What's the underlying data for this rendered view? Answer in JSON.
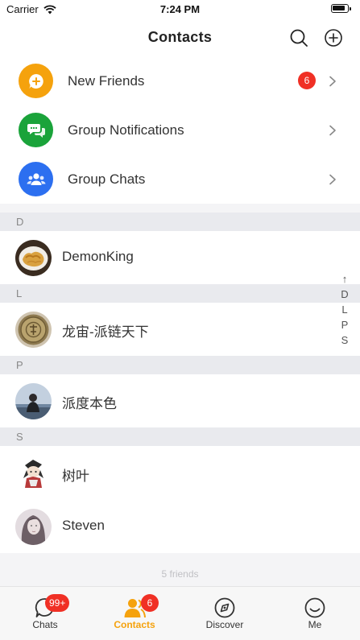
{
  "status_bar": {
    "carrier": "Carrier",
    "time": "7:24 PM"
  },
  "nav": {
    "title": "Contacts"
  },
  "functions": [
    {
      "label": "New Friends",
      "badge": "6",
      "color": "#f5a20d",
      "icon": "plus-chat-icon"
    },
    {
      "label": "Group Notifications",
      "badge": "",
      "color": "#1aa33a",
      "icon": "chat-bubbles-icon"
    },
    {
      "label": "Group Chats",
      "badge": "",
      "color": "#2c6ff0",
      "icon": "group-icon"
    }
  ],
  "sections": [
    {
      "letter": "D",
      "contacts": [
        {
          "name": "DemonKing"
        }
      ]
    },
    {
      "letter": "L",
      "contacts": [
        {
          "name": "龙宙-派链天下"
        }
      ]
    },
    {
      "letter": "P",
      "contacts": [
        {
          "name": "派度本色"
        }
      ]
    },
    {
      "letter": "S",
      "contacts": [
        {
          "name": "树叶"
        },
        {
          "name": "Steven"
        }
      ]
    }
  ],
  "index": {
    "arrow": "↑",
    "letters": [
      "D",
      "L",
      "P",
      "S"
    ]
  },
  "footer": {
    "friends_count": "5 friends"
  },
  "tabs": [
    {
      "label": "Chats",
      "badge": "99+",
      "icon": "chat-bubble-icon",
      "active": false
    },
    {
      "label": "Contacts",
      "badge": "6",
      "icon": "contacts-person-icon",
      "active": true
    },
    {
      "label": "Discover",
      "badge": "",
      "icon": "compass-icon",
      "active": false
    },
    {
      "label": "Me",
      "badge": "",
      "icon": "smiley-face-icon",
      "active": false
    }
  ],
  "colors": {
    "accent": "#f5a20d",
    "badge": "#f03025",
    "section_bg": "#e9eaee"
  }
}
